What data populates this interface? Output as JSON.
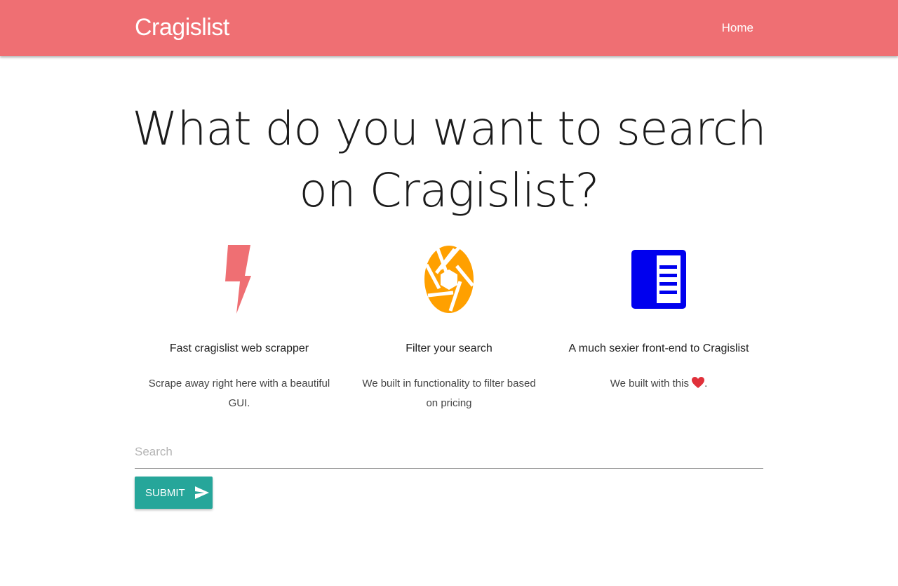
{
  "nav": {
    "brand": "Cragislist",
    "links": [
      {
        "label": "Home"
      }
    ],
    "color": "#ef6f73"
  },
  "hero": {
    "title": "What do you want to search on Cragislist?"
  },
  "features": [
    {
      "icon": "lightning-bolt-icon",
      "icon_color": "#ef6f73",
      "title": "Fast cragislist web scrapper",
      "text": "Scrape away right here with a beautiful GUI."
    },
    {
      "icon": "camera-aperture-icon",
      "icon_color": "#ffa000",
      "title": "Filter your search",
      "text": "We built in functionality to filter based on pricing"
    },
    {
      "icon": "article-document-icon",
      "icon_color": "#0000ee",
      "title": "A much sexier front-end to Cragislist",
      "text": "We built with this",
      "text_suffix": "."
    }
  ],
  "search": {
    "placeholder": "Search",
    "value": ""
  },
  "submit": {
    "label": "SUBMIT",
    "icon": "send-icon",
    "color": "#26a69a"
  }
}
